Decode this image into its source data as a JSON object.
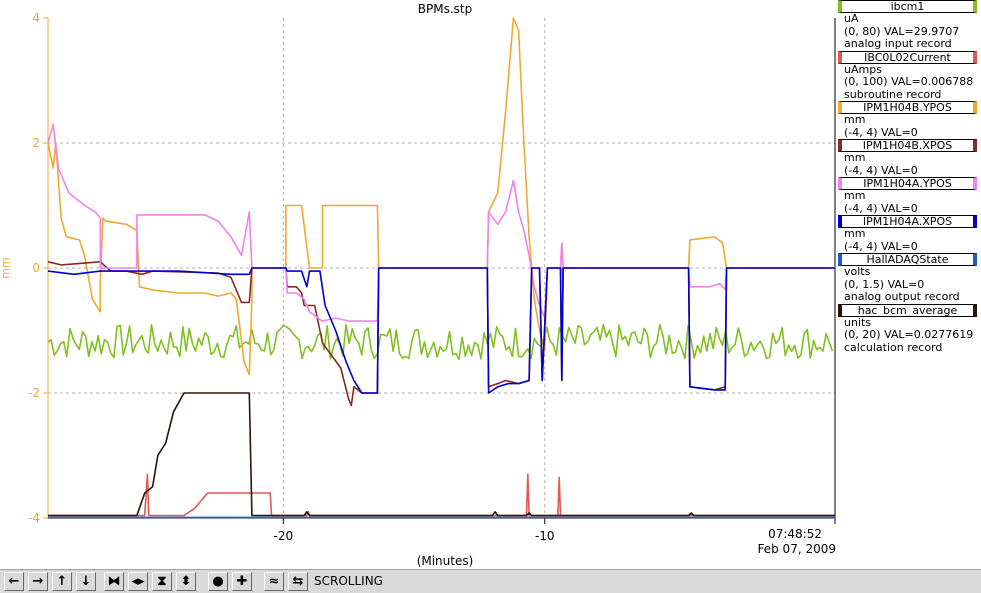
{
  "window": {
    "title": "BPMs.stp"
  },
  "axes": {
    "left_unit": "mm",
    "x_title": "(Minutes)",
    "x_ticks": [
      "-20",
      "-10"
    ],
    "y_ticks": [
      "4",
      "2",
      "0",
      "-2",
      "-4"
    ],
    "end_time": "07:48:52",
    "end_date": "Feb 07, 2009"
  },
  "legend": [
    {
      "name": "ibcm1",
      "color": "#7fc11f",
      "unit": "uA",
      "range": "(0, 80) VAL=29.9707",
      "type": "analog input record"
    },
    {
      "name": "IBC0L02Current",
      "color": "#e0584f",
      "unit": "uAmps",
      "range": "(0, 100) VAL=0.006788",
      "type": "subroutine record"
    },
    {
      "name": "IPM1H04B.YPOS",
      "color": "#f0a830",
      "unit": "mm",
      "range": "(-4, 4) VAL=0",
      "type": ""
    },
    {
      "name": "IPM1H04B.XPOS",
      "color": "#8b2a1f",
      "unit": "mm",
      "range": "(-4, 4) VAL=0",
      "type": ""
    },
    {
      "name": "IPM1H04A.YPOS",
      "color": "#ee82ee",
      "unit": "mm",
      "range": "(-4, 4) VAL=0",
      "type": ""
    },
    {
      "name": "IPM1H04A.XPOS",
      "color": "#0000cd",
      "unit": "mm",
      "range": "(-4, 4) VAL=0",
      "type": ""
    },
    {
      "name": "HallADAQState",
      "color": "#1e5cc8",
      "unit": "volts",
      "range": "(0, 1.5) VAL=0",
      "type": "analog output record"
    },
    {
      "name": "hac_bcm_average",
      "color": "#2a1208",
      "unit": "units",
      "range": "(0, 20) VAL=0.0277619",
      "type": "calculation record"
    }
  ],
  "toolbar": {
    "status": "SCROLLING",
    "buttons": [
      {
        "icon": "arrow-left-icon",
        "glyph": "←"
      },
      {
        "icon": "arrow-right-icon",
        "glyph": "→"
      },
      {
        "icon": "arrow-up-icon",
        "glyph": "↑"
      },
      {
        "icon": "arrow-down-icon",
        "glyph": "↓"
      },
      {
        "icon": "zoom-in-x-icon",
        "glyph": "⧓"
      },
      {
        "icon": "zoom-out-x-icon",
        "glyph": "◂▸"
      },
      {
        "icon": "zoom-in-y-icon",
        "glyph": "⧗"
      },
      {
        "icon": "zoom-out-y-icon",
        "glyph": "⬍"
      },
      {
        "icon": "stop-icon",
        "glyph": "●"
      },
      {
        "icon": "add-icon",
        "glyph": "✚"
      },
      {
        "icon": "config-icon",
        "glyph": "≈"
      },
      {
        "icon": "scroll-icon",
        "glyph": "⇆"
      }
    ]
  },
  "chart_data": {
    "type": "line",
    "title": "BPMs.stp",
    "xlabel": "(Minutes)",
    "ylabel": "mm",
    "xlim": [
      -29,
      1.1
    ],
    "ylim": [
      -4,
      4
    ],
    "grid": true,
    "series": [
      {
        "name": "ibcm1",
        "color": "#7fc11f",
        "kind": "noise",
        "center": -1.18,
        "amp": 0.28,
        "points": [
          [
            -29,
            -1.15
          ],
          [
            1.1,
            -1.15
          ]
        ]
      },
      {
        "name": "IBC0L02Current",
        "color": "#e0584f",
        "points": [
          [
            -29,
            -3.96
          ],
          [
            -26.5,
            -3.96
          ],
          [
            -25.3,
            -3.96
          ],
          [
            -25.2,
            -3.3
          ],
          [
            -25.15,
            -3.96
          ],
          [
            -23.8,
            -3.96
          ],
          [
            -23.4,
            -3.85
          ],
          [
            -22.9,
            -3.6
          ],
          [
            -21.2,
            -3.6
          ],
          [
            -20.5,
            -3.6
          ],
          [
            -20.45,
            -3.96
          ],
          [
            -19.1,
            -3.96
          ],
          [
            -19.05,
            -3.9
          ],
          [
            -19.0,
            -3.96
          ],
          [
            -15.5,
            -3.96
          ],
          [
            -10.7,
            -3.96
          ],
          [
            -10.65,
            -3.3
          ],
          [
            -10.6,
            -3.96
          ],
          [
            -10.0,
            -3.96
          ],
          [
            -9.5,
            -3.96
          ],
          [
            -9.45,
            -3.35
          ],
          [
            -9.4,
            -3.96
          ],
          [
            -6.5,
            -3.96
          ],
          [
            -4.5,
            -3.96
          ],
          [
            -3.0,
            -3.96
          ],
          [
            -2.5,
            -3.96
          ],
          [
            1.1,
            -3.96
          ]
        ]
      },
      {
        "name": "IPM1H04B.YPOS",
        "color": "#f0a830",
        "points": [
          [
            -29,
            2.0
          ],
          [
            -28.8,
            1.6
          ],
          [
            -28.7,
            2.0
          ],
          [
            -28.5,
            0.8
          ],
          [
            -28.3,
            0.5
          ],
          [
            -27.8,
            0.45
          ],
          [
            -27.6,
            0.2
          ],
          [
            -27.3,
            -0.5
          ],
          [
            -27.0,
            -0.7
          ],
          [
            -27.0,
            -0.2
          ],
          [
            -26.9,
            0.8
          ],
          [
            -26.8,
            0.75
          ],
          [
            -26.0,
            0.7
          ],
          [
            -25.6,
            0.6
          ],
          [
            -25.5,
            -0.3
          ],
          [
            -25.0,
            -0.35
          ],
          [
            -24.0,
            -0.4
          ],
          [
            -23.0,
            -0.4
          ],
          [
            -22.5,
            -0.45
          ],
          [
            -22.0,
            -0.4
          ],
          [
            -21.8,
            -0.5
          ],
          [
            -21.5,
            -1.5
          ],
          [
            -21.3,
            -1.7
          ],
          [
            -21.2,
            -0.5
          ],
          [
            -21.2,
            0
          ],
          [
            -19.9,
            0
          ],
          [
            -19.9,
            1.0
          ],
          [
            -19.5,
            1.0
          ],
          [
            -19.3,
            1.0
          ],
          [
            -19.0,
            0
          ],
          [
            -18.5,
            0
          ],
          [
            -18.5,
            1.0
          ],
          [
            -17.0,
            1.0
          ],
          [
            -16.4,
            1.0
          ],
          [
            -16.35,
            0
          ],
          [
            -12.2,
            0
          ],
          [
            -12.15,
            0.9
          ],
          [
            -11.8,
            1.2
          ],
          [
            -11.5,
            2.5
          ],
          [
            -11.2,
            4.0
          ],
          [
            -11.0,
            3.8
          ],
          [
            -10.8,
            2.0
          ],
          [
            -10.6,
            0.5
          ],
          [
            -10.4,
            -0.5
          ],
          [
            -10.2,
            -1.0
          ],
          [
            -10.0,
            -1.3
          ],
          [
            -9.9,
            0
          ],
          [
            -9.4,
            0
          ],
          [
            -9.35,
            0.4
          ],
          [
            -9.3,
            0
          ],
          [
            -4.5,
            0
          ],
          [
            -4.45,
            0.45
          ],
          [
            -3.5,
            0.5
          ],
          [
            -3.2,
            0.4
          ],
          [
            -3.05,
            0
          ],
          [
            1.1,
            0
          ]
        ]
      },
      {
        "name": "IPM1H04B.XPOS",
        "color": "#8b2a1f",
        "points": [
          [
            -29,
            0.1
          ],
          [
            -28.5,
            0.05
          ],
          [
            -27.0,
            0.1
          ],
          [
            -26.6,
            -0.05
          ],
          [
            -26.0,
            -0.05
          ],
          [
            -25.4,
            -0.1
          ],
          [
            -25.0,
            -0.05
          ],
          [
            -22.5,
            -0.08
          ],
          [
            -22.0,
            -0.15
          ],
          [
            -21.6,
            -0.55
          ],
          [
            -21.3,
            -0.55
          ],
          [
            -21.2,
            0
          ],
          [
            -19.9,
            0
          ],
          [
            -19.85,
            -0.3
          ],
          [
            -19.5,
            -0.3
          ],
          [
            -19.3,
            -0.4
          ],
          [
            -19.2,
            -0.6
          ],
          [
            -18.8,
            -0.6
          ],
          [
            -18.5,
            -1.2
          ],
          [
            -17.8,
            -1.6
          ],
          [
            -17.5,
            -2.1
          ],
          [
            -17.4,
            -2.2
          ],
          [
            -17.3,
            -1.9
          ],
          [
            -17.0,
            -2.0
          ],
          [
            -16.4,
            -2.0
          ],
          [
            -16.35,
            0
          ],
          [
            -12.2,
            0
          ],
          [
            -12.15,
            -1.9
          ],
          [
            -11.8,
            -1.85
          ],
          [
            -11.5,
            -1.8
          ],
          [
            -11.0,
            -1.85
          ],
          [
            -10.6,
            -1.8
          ],
          [
            -10.5,
            0
          ],
          [
            -10.2,
            0
          ],
          [
            -10.1,
            -1.8
          ],
          [
            -9.9,
            0
          ],
          [
            -9.4,
            0
          ],
          [
            -9.35,
            -1.8
          ],
          [
            -9.3,
            0
          ],
          [
            -4.5,
            0
          ],
          [
            -4.45,
            -1.9
          ],
          [
            -3.5,
            -1.95
          ],
          [
            -3.1,
            -1.9
          ],
          [
            -3.05,
            0
          ],
          [
            1.1,
            0
          ]
        ]
      },
      {
        "name": "IPM1H04A.YPOS",
        "color": "#ee82ee",
        "points": [
          [
            -29,
            2.0
          ],
          [
            -28.8,
            2.3
          ],
          [
            -28.6,
            1.6
          ],
          [
            -28.2,
            1.2
          ],
          [
            -27.6,
            1.0
          ],
          [
            -27.2,
            0.9
          ],
          [
            -27.0,
            0.8
          ],
          [
            -27.0,
            0
          ],
          [
            -25.6,
            0
          ],
          [
            -25.6,
            0.85
          ],
          [
            -24.5,
            0.85
          ],
          [
            -23.0,
            0.85
          ],
          [
            -22.5,
            0.75
          ],
          [
            -22.0,
            0.5
          ],
          [
            -21.6,
            0.2
          ],
          [
            -21.3,
            0.9
          ],
          [
            -21.2,
            0
          ],
          [
            -19.9,
            0
          ],
          [
            -19.85,
            -0.4
          ],
          [
            -19.5,
            -0.4
          ],
          [
            -19.2,
            -0.5
          ],
          [
            -19.0,
            -0.7
          ],
          [
            -18.5,
            -0.85
          ],
          [
            -18.0,
            -0.8
          ],
          [
            -17.5,
            -0.85
          ],
          [
            -17.0,
            -0.85
          ],
          [
            -16.4,
            -0.85
          ],
          [
            -16.35,
            0
          ],
          [
            -12.2,
            0
          ],
          [
            -12.15,
            0.9
          ],
          [
            -11.8,
            0.7
          ],
          [
            -11.5,
            0.9
          ],
          [
            -11.2,
            1.4
          ],
          [
            -11.0,
            0.9
          ],
          [
            -10.8,
            0.6
          ],
          [
            -10.6,
            0.2
          ],
          [
            -10.4,
            -0.3
          ],
          [
            -10.2,
            -0.6
          ],
          [
            -10.0,
            -0.8
          ],
          [
            -9.9,
            0
          ],
          [
            -9.4,
            0
          ],
          [
            -9.35,
            0.4
          ],
          [
            -9.3,
            0
          ],
          [
            -4.5,
            0
          ],
          [
            -4.45,
            -0.3
          ],
          [
            -3.7,
            -0.3
          ],
          [
            -3.3,
            -0.25
          ],
          [
            -3.1,
            -0.35
          ],
          [
            -3.05,
            0
          ],
          [
            1.1,
            0
          ]
        ]
      },
      {
        "name": "IPM1H04A.XPOS",
        "color": "#0000cd",
        "points": [
          [
            -29,
            -0.05
          ],
          [
            -28.0,
            -0.1
          ],
          [
            -27.0,
            -0.05
          ],
          [
            -26.9,
            -0.05
          ],
          [
            -25.6,
            -0.05
          ],
          [
            -24.0,
            -0.05
          ],
          [
            -22.0,
            -0.1
          ],
          [
            -21.3,
            -0.1
          ],
          [
            -21.2,
            0
          ],
          [
            -19.9,
            0
          ],
          [
            -19.85,
            -0.05
          ],
          [
            -19.3,
            -0.05
          ],
          [
            -19.1,
            -0.3
          ],
          [
            -19.0,
            -0.05
          ],
          [
            -18.6,
            -0.05
          ],
          [
            -18.4,
            -0.6
          ],
          [
            -18.0,
            -1.0
          ],
          [
            -17.6,
            -1.5
          ],
          [
            -17.3,
            -1.8
          ],
          [
            -17.0,
            -2.0
          ],
          [
            -16.4,
            -2.0
          ],
          [
            -16.35,
            0
          ],
          [
            -12.2,
            0
          ],
          [
            -12.15,
            -2.0
          ],
          [
            -11.8,
            -1.9
          ],
          [
            -11.4,
            -1.85
          ],
          [
            -11.0,
            -1.85
          ],
          [
            -10.6,
            -1.8
          ],
          [
            -10.5,
            0
          ],
          [
            -10.2,
            0
          ],
          [
            -10.1,
            -1.8
          ],
          [
            -9.9,
            0
          ],
          [
            -9.4,
            0
          ],
          [
            -9.35,
            -1.8
          ],
          [
            -9.3,
            0
          ],
          [
            -4.5,
            0
          ],
          [
            -4.45,
            -1.9
          ],
          [
            -3.5,
            -1.95
          ],
          [
            -3.1,
            -1.95
          ],
          [
            -3.05,
            0
          ],
          [
            1.1,
            0
          ]
        ]
      },
      {
        "name": "HallADAQState",
        "color": "#1e5cc8",
        "points": [
          [
            -29,
            -3.99
          ],
          [
            1.1,
            -3.99
          ]
        ]
      },
      {
        "name": "hac_bcm_average",
        "color": "#2a1208",
        "points": [
          [
            -29,
            -3.96
          ],
          [
            -26.5,
            -3.96
          ],
          [
            -25.6,
            -3.96
          ],
          [
            -25.3,
            -3.6
          ],
          [
            -25.0,
            -3.5
          ],
          [
            -24.8,
            -3.0
          ],
          [
            -24.5,
            -2.8
          ],
          [
            -24.2,
            -2.3
          ],
          [
            -23.8,
            -2.0
          ],
          [
            -21.3,
            -2.0
          ],
          [
            -21.2,
            -3.96
          ],
          [
            -19.2,
            -3.96
          ],
          [
            -19.1,
            -3.9
          ],
          [
            -19.0,
            -3.96
          ],
          [
            -12.0,
            -3.96
          ],
          [
            -11.9,
            -3.9
          ],
          [
            -11.8,
            -3.96
          ],
          [
            -10.7,
            -3.96
          ],
          [
            -10.6,
            -3.92
          ],
          [
            -10.5,
            -3.96
          ],
          [
            -4.5,
            -3.96
          ],
          [
            -4.4,
            -3.92
          ],
          [
            -4.3,
            -3.96
          ],
          [
            1.1,
            -3.96
          ]
        ]
      }
    ]
  }
}
